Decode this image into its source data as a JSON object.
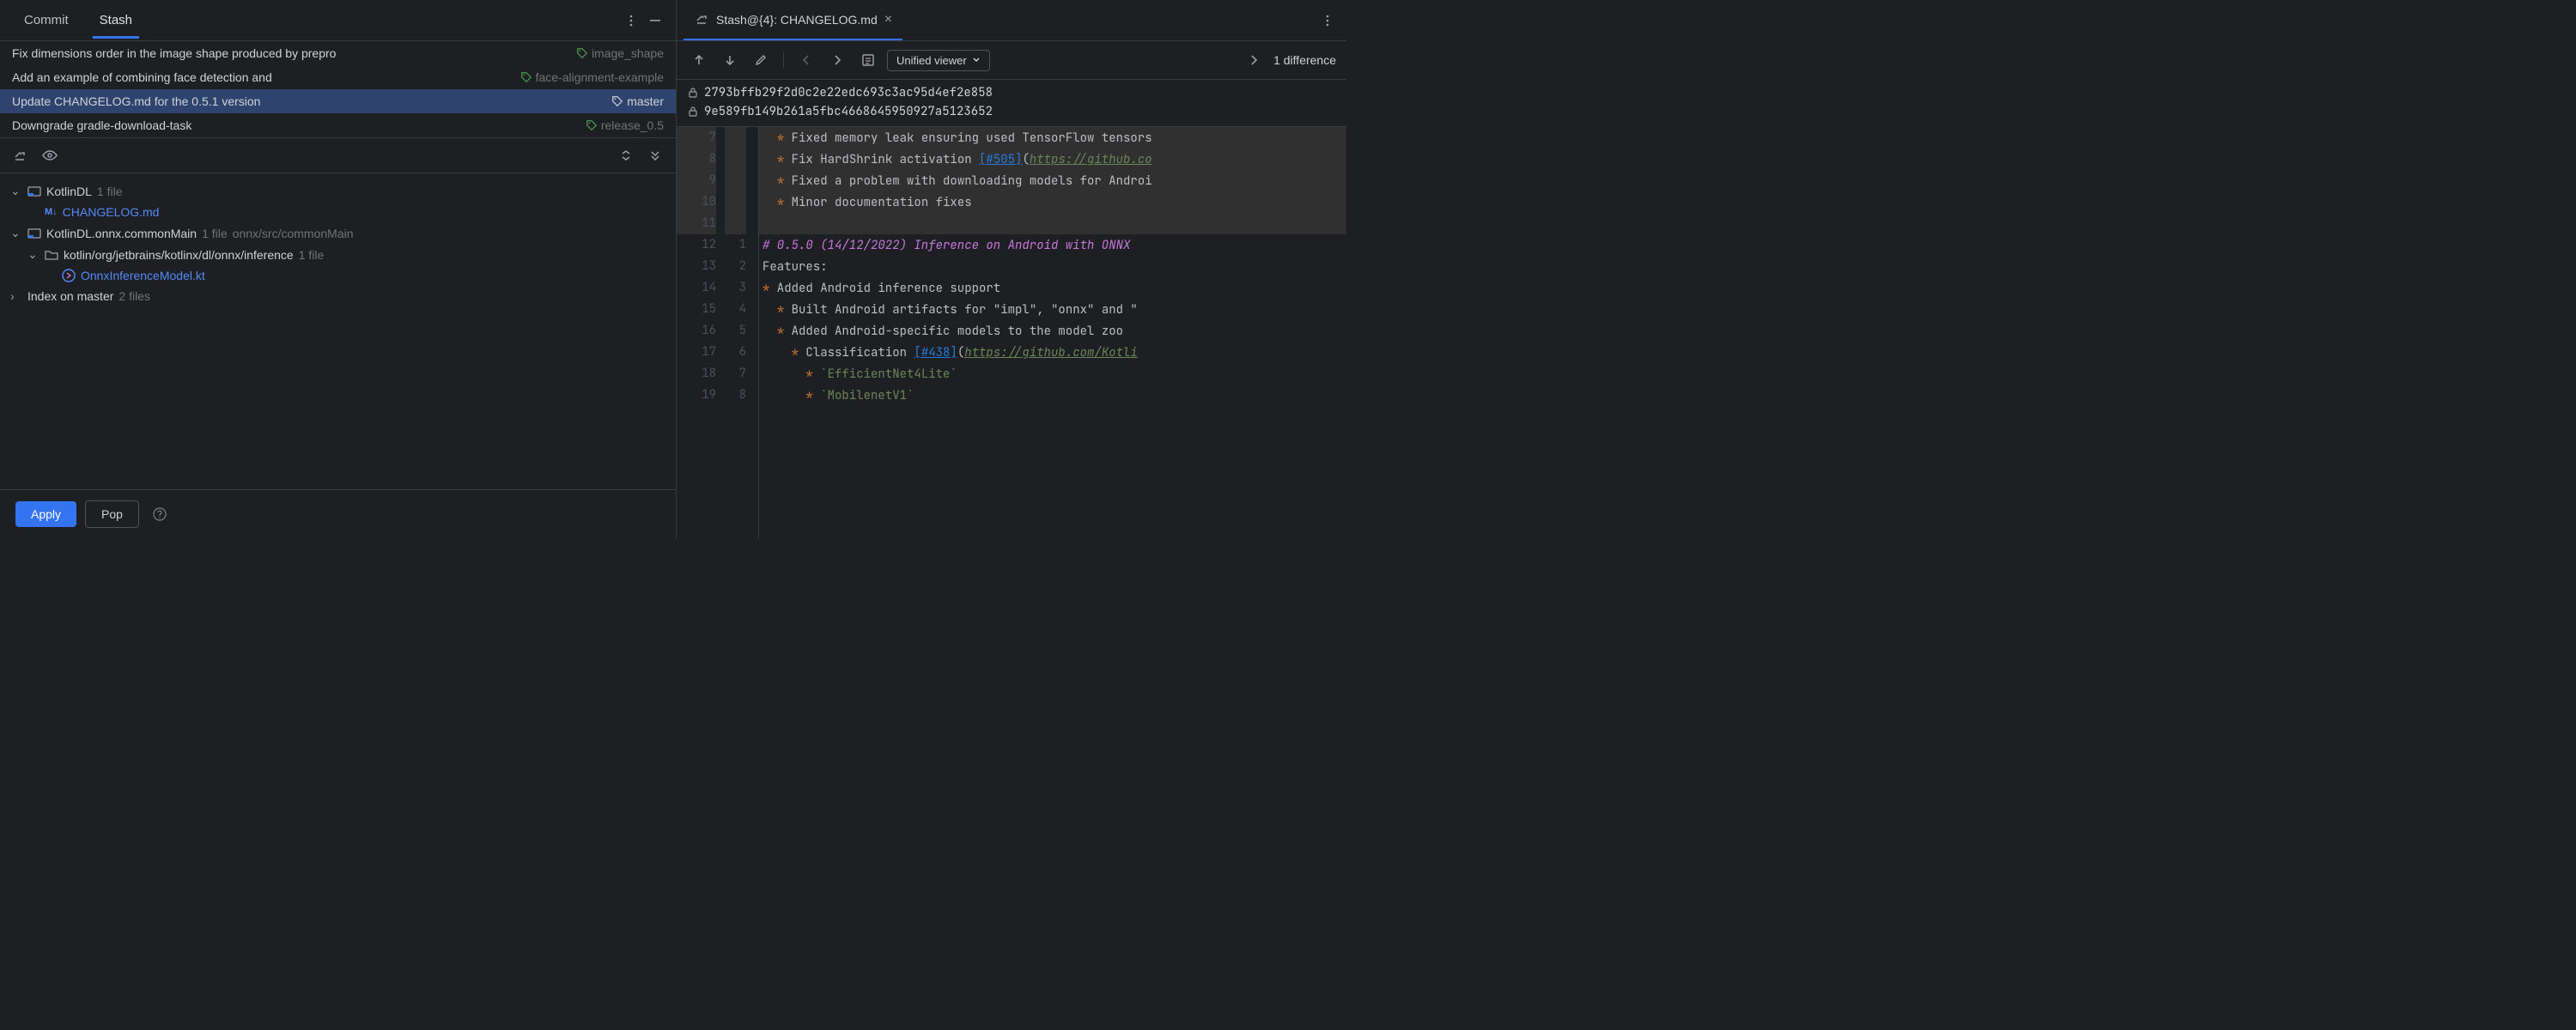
{
  "tabs": {
    "commit": "Commit",
    "stash": "Stash"
  },
  "commits": [
    {
      "msg": "Fix dimensions order in the image shape produced by prepro",
      "tag": "image_shape",
      "active": false
    },
    {
      "msg": "Add an example of combining face detection and ",
      "tag": "face-alignment-example",
      "active": false
    },
    {
      "msg": "Update CHANGELOG.md for the 0.5.1 version",
      "tag": "master",
      "active": true
    },
    {
      "msg": "Downgrade gradle-download-task",
      "tag": "release_0.5",
      "active": false
    }
  ],
  "tree": {
    "root1": "KotlinDL",
    "root1_count": "1 file",
    "file1": "CHANGELOG.md",
    "root2": "KotlinDL.onnx.commonMain",
    "root2_count": "1 file",
    "root2_path": "onnx/src/commonMain",
    "pkg": "kotlin/org/jetbrains/kotlinx/dl/onnx/inference",
    "pkg_count": "1 file",
    "file2": "OnnxInferenceModel.kt",
    "index": "Index on master",
    "index_count": "2 files"
  },
  "buttons": {
    "apply": "Apply",
    "pop": "Pop"
  },
  "rightTab": "Stash@{4}: CHANGELOG.md",
  "viewer": "Unified viewer",
  "diffCount": "1 difference",
  "hash1": "2793bffb29f2d0c2e22edc693c3ac95d4ef2e858",
  "hash2": "9e589fb149b261a5fbc4668645950927a5123652",
  "code": {
    "l7": {
      "ln1": "7",
      "ln2": "",
      "bg": "old",
      "pre": "  ",
      "star": "*",
      "text": " Fixed memory leak ensuring used TensorFlow tensors"
    },
    "l8": {
      "ln1": "8",
      "ln2": "",
      "bg": "old",
      "pre": "  ",
      "star": "*",
      "text": " Fix HardShrink activation ",
      "link": "[#505]",
      "paren": "(",
      "url": "https://github.co"
    },
    "l9": {
      "ln1": "9",
      "ln2": "",
      "bg": "old",
      "pre": "  ",
      "star": "*",
      "text": " Fixed a problem with downloading models for Androi"
    },
    "l10": {
      "ln1": "10",
      "ln2": "",
      "bg": "old",
      "pre": "  ",
      "star": "*",
      "text": " Minor documentation fixes"
    },
    "l11": {
      "ln1": "11",
      "ln2": "",
      "bg": "old"
    },
    "l12": {
      "ln1": "12",
      "ln2": "1",
      "head": "# 0.5.0 (14/12/2022) Inference on Android with ONNX"
    },
    "l13": {
      "ln1": "13",
      "ln2": "2",
      "text": "Features:"
    },
    "l14": {
      "ln1": "14",
      "ln2": "3",
      "star": "*",
      "text": " Added Android inference support"
    },
    "l15": {
      "ln1": "15",
      "ln2": "4",
      "pre": "  ",
      "star": "*",
      "text": " Built Android artifacts for \"impl\", \"onnx\" and \""
    },
    "l16": {
      "ln1": "16",
      "ln2": "5",
      "pre": "  ",
      "star": "*",
      "text": " Added Android-specific models to the model zoo"
    },
    "l17": {
      "ln1": "17",
      "ln2": "6",
      "pre": "    ",
      "star": "*",
      "text": " Classification ",
      "link": "[#438]",
      "paren": "(",
      "url": "https://github.com/Kotli"
    },
    "l18": {
      "ln1": "18",
      "ln2": "7",
      "pre": "      ",
      "star": "*",
      "text": " ",
      "code": "`EfficientNet4Lite`"
    },
    "l19": {
      "ln1": "19",
      "ln2": "8",
      "pre": "      ",
      "star": "*",
      "text": " ",
      "code": "`MobilenetV1`"
    }
  }
}
